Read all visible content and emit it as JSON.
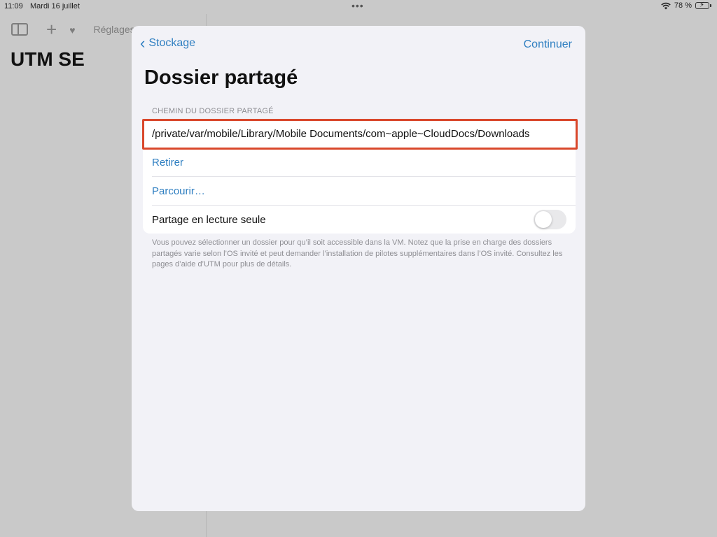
{
  "status_bar": {
    "time": "11:09",
    "date": "Mardi 16 juillet",
    "multitask_dots": "•••",
    "battery_percent": "78 %",
    "battery_level": 0.78,
    "battery_charging": true,
    "icons": [
      "wifi-icon",
      "battery-icon"
    ]
  },
  "sidebar": {
    "title": "UTM SE",
    "toolbar": {
      "settings_label": "Réglages",
      "icons": [
        "sidebar-toggle-icon",
        "plus-icon",
        "heart-icon"
      ]
    }
  },
  "sheet": {
    "back_label": "Stockage",
    "continue_label": "Continuer",
    "title": "Dossier partagé",
    "section_header": "CHEMIN DU DOSSIER PARTAGÉ",
    "path_value": "/private/var/mobile/Library/Mobile Documents/com~apple~CloudDocs/Downloads",
    "remove_label": "Retirer",
    "browse_label": "Parcourir…",
    "readonly_label": "Partage en lecture seule",
    "readonly_enabled": false,
    "footer": "Vous pouvez sélectionner un dossier pour qu’il soit accessible dans la VM. Notez que la prise en charge des dossiers partagés varie selon l’OS invité et peut demander l’installation de pilotes supplémentaires dans l’OS invité. Consultez les pages d’aide d’UTM pour plus de détails."
  },
  "colors": {
    "accent": "#2f7fc1",
    "highlight_border": "#d9472b",
    "battery_fill": "#34c759",
    "background_dim": "#c9c9c9",
    "sheet_background": "#f2f2f7"
  }
}
